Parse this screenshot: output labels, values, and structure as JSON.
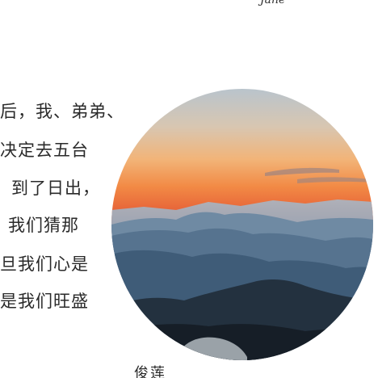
{
  "caption_top": "Jane",
  "paragraph_lines": [
    "后，我、弟弟、",
    "决定去五台",
    "到了日出，",
    "我们猜那",
    "旦我们心是",
    "是我们旺盛"
  ],
  "author": "俊莲"
}
